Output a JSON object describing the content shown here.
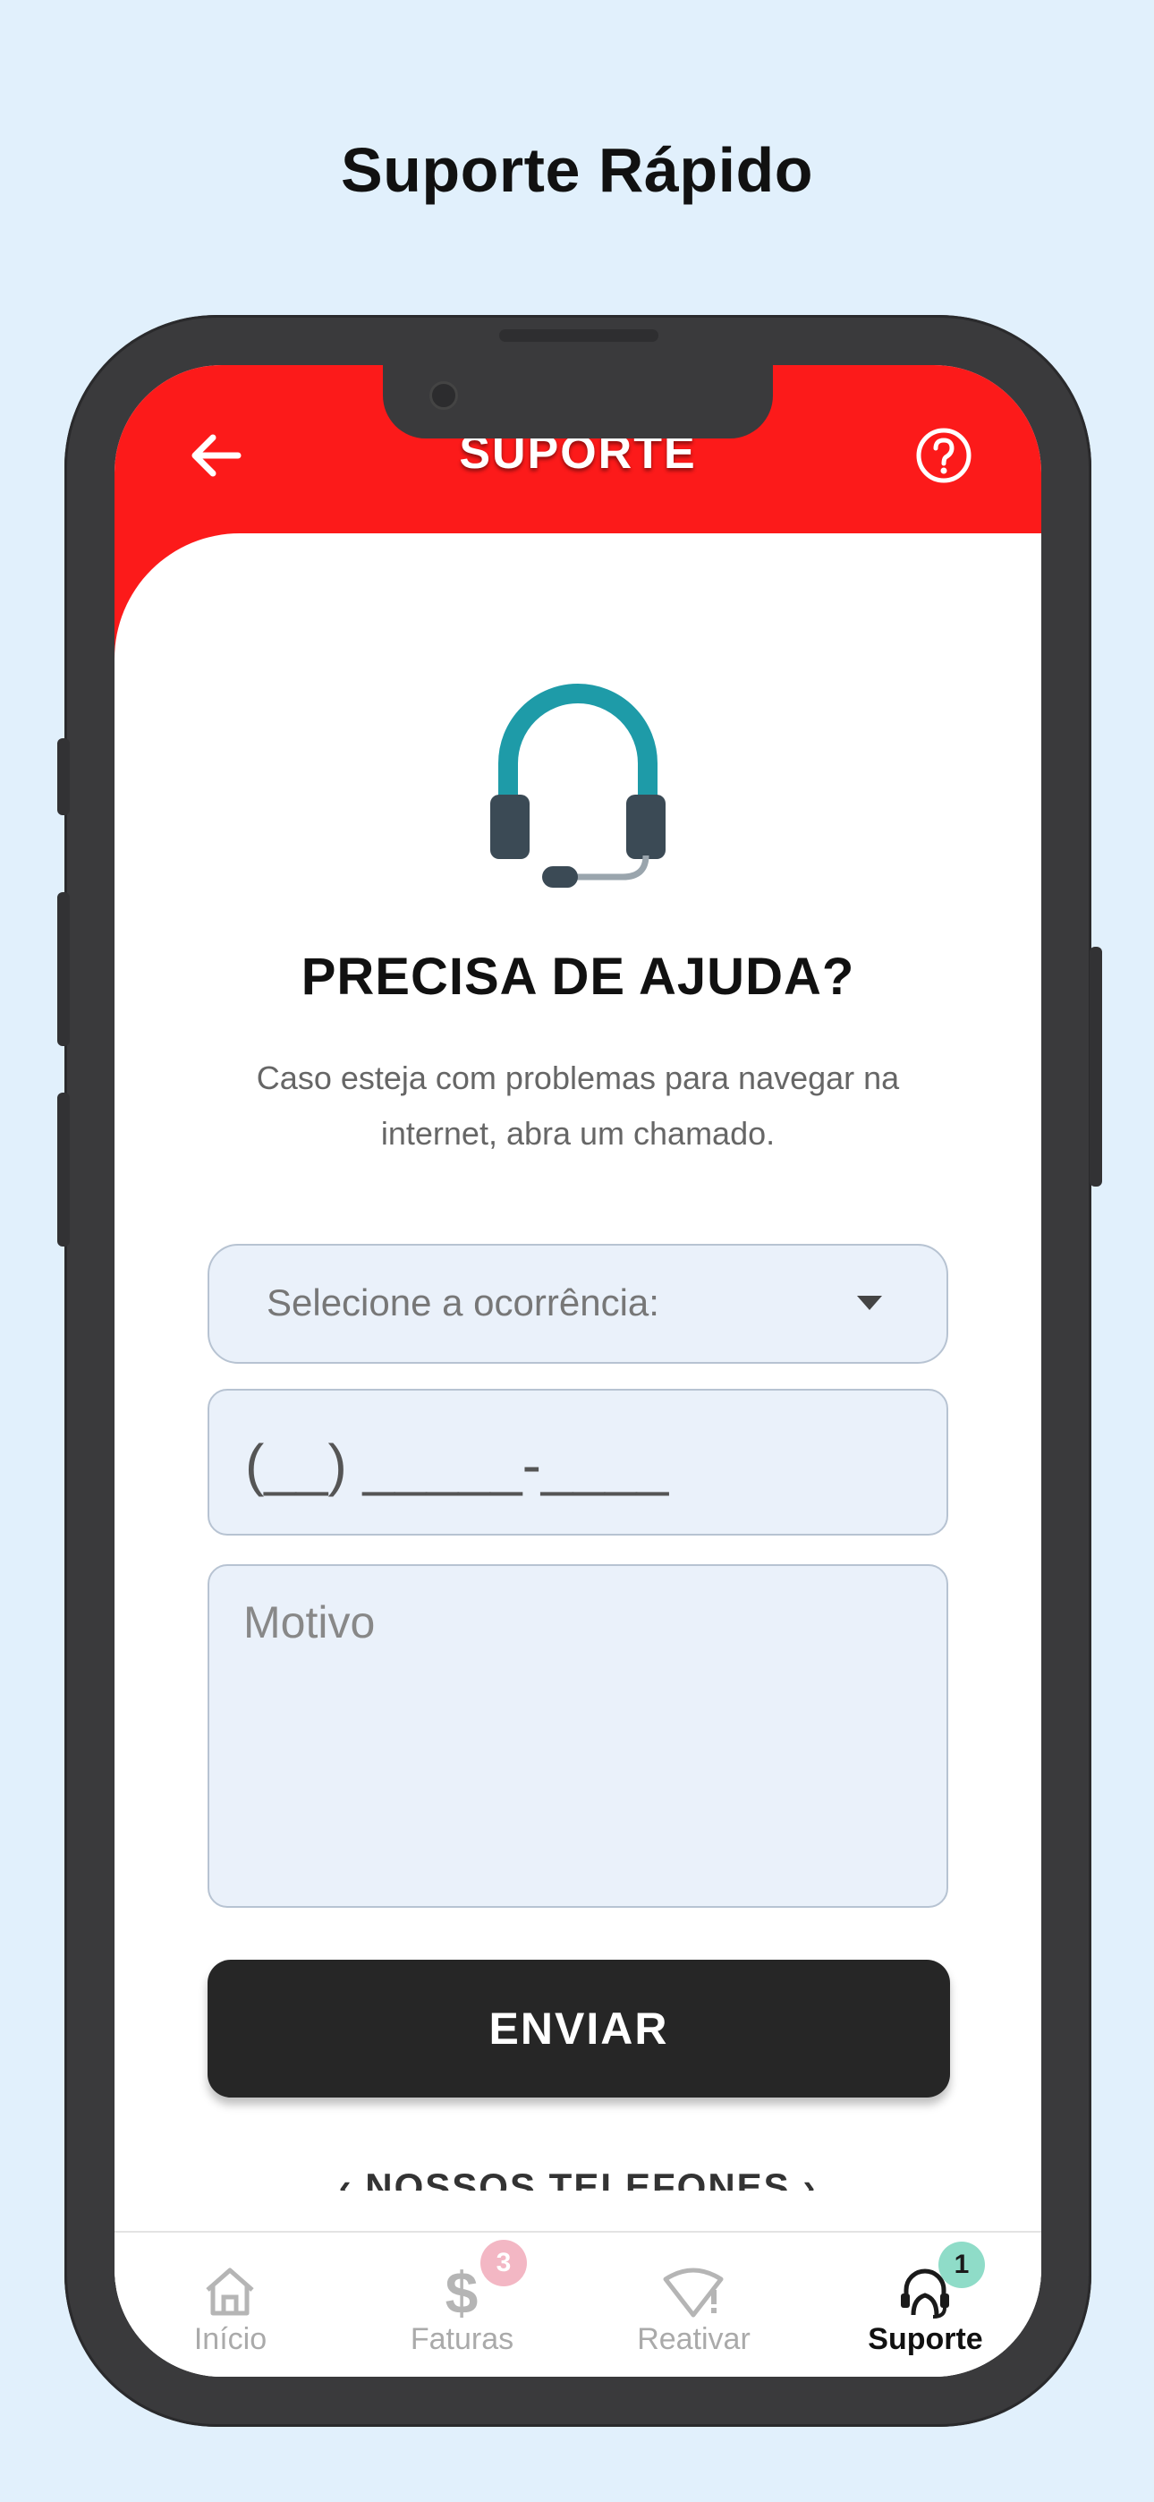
{
  "promo": {
    "title": "Suporte Rápido"
  },
  "header": {
    "title": "SUPORTE"
  },
  "content": {
    "heading": "PRECISA DE AJUDA?",
    "description": "Caso esteja com problemas para navegar na internet, abra um chamado."
  },
  "form": {
    "occurrence_placeholder": "Selecione a ocorrência:",
    "phone_placeholder": "(__) _____-____",
    "reason_placeholder": "Motivo",
    "submit_label": "ENVIAR"
  },
  "phones_link": {
    "label": "NOSSOS TELEFONES"
  },
  "tabbar": {
    "items": [
      {
        "label": "Início",
        "icon": "home-icon"
      },
      {
        "label": "Faturas",
        "icon": "dollar-icon",
        "badge": "3"
      },
      {
        "label": "Reativar",
        "icon": "wifi-alert-icon"
      },
      {
        "label": "Suporte",
        "icon": "support-agent-icon",
        "badge": "1",
        "active": true
      }
    ]
  },
  "colors": {
    "header_red": "#fc1a1a",
    "button_dark": "#262626",
    "headset_teal": "#1e9ba8",
    "faturas_badge": "#f3b7c4",
    "suporte_badge": "#8fdcc8",
    "background": "#e1f0fc"
  }
}
